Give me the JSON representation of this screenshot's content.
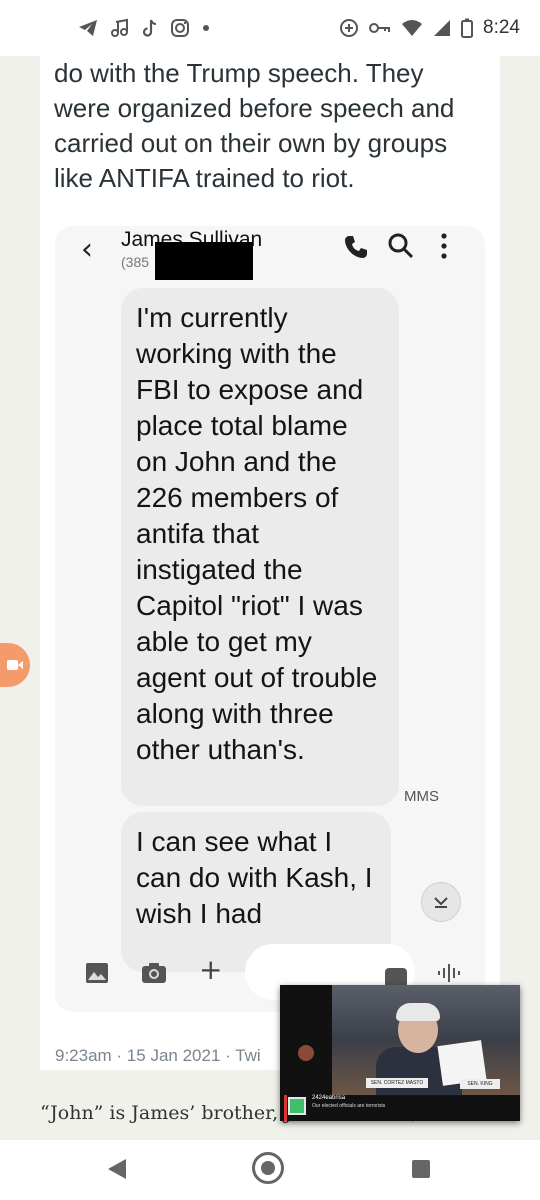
{
  "status_bar": {
    "time": "8:24",
    "left_icons": [
      "telegram-icon",
      "music-icon",
      "tiktok-icon",
      "instagram-icon",
      "dot-icon"
    ],
    "right_icons": [
      "data-saver-icon",
      "vpn-key-icon",
      "wifi-icon",
      "signal-icon",
      "battery-icon"
    ]
  },
  "tweet": {
    "text": "do with the Trump speech. They were organized before speech and carried out on their own by groups like ANTIFA trained to riot.",
    "timestamp": "9:23am · 15 Jan 2021 · Twi"
  },
  "sms_screenshot": {
    "contact_name": "James Sullivan",
    "contact_number": "(385",
    "bubbles": [
      "I'm currently working with the FBI to expose and place total blame on John and the 226 members of antifa that instigated the Capitol \"riot\" I was able to get my agent out of trouble along with three other uthan's.",
      "I can see what I can do with Kash, I wish I had"
    ],
    "mms_label": "MMS",
    "icons": [
      "back-icon",
      "phone-icon",
      "search-icon",
      "more-vert-icon",
      "scroll-down-icon",
      "gallery-icon",
      "camera-icon",
      "plus-icon",
      "sticker-icon",
      "voice-icon"
    ]
  },
  "caption": {
    "text": "“John” is James’ brother, John Sullivan, someone"
  },
  "video_overlay": {
    "handle": "2424eabrisa",
    "ticker": "Our elected officials are terrorists",
    "nameplate_1": "SEN. CORTEZ MASTO",
    "nameplate_2": "SEN. KING"
  },
  "nav_bar": {
    "buttons": [
      "back",
      "home",
      "recents"
    ]
  }
}
